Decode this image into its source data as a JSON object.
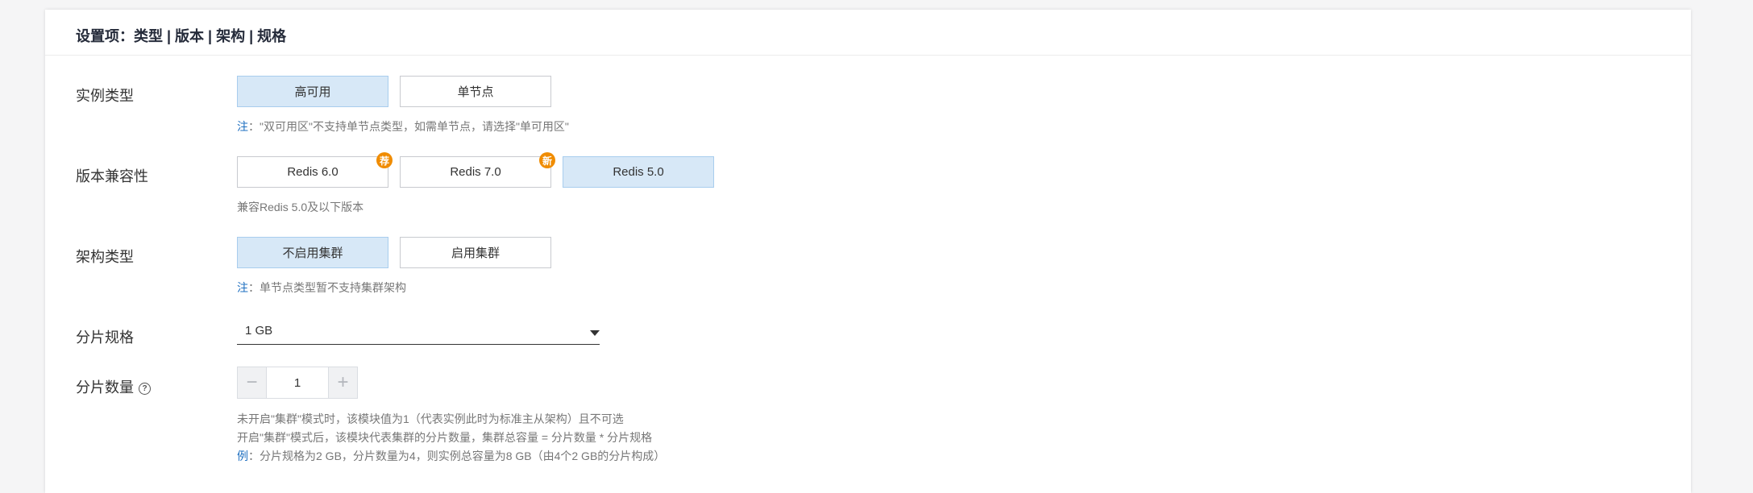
{
  "header": {
    "title": "设置项：类型 | 版本 | 架构 | 规格"
  },
  "instance_type": {
    "label": "实例类型",
    "options": [
      {
        "label": "高可用",
        "selected": true
      },
      {
        "label": "单节点",
        "selected": false
      }
    ],
    "note_lead": "注",
    "note_text": "：\"双可用区\"不支持单节点类型，如需单节点，请选择\"单可用区\""
  },
  "version": {
    "label": "版本兼容性",
    "options": [
      {
        "label": "Redis 6.0",
        "badge": "荐",
        "selected": false
      },
      {
        "label": "Redis 7.0",
        "badge": "新",
        "selected": false
      },
      {
        "label": "Redis 5.0",
        "badge": "",
        "selected": true
      }
    ],
    "note_text": "兼容Redis 5.0及以下版本"
  },
  "architecture": {
    "label": "架构类型",
    "options": [
      {
        "label": "不启用集群",
        "selected": true
      },
      {
        "label": "启用集群",
        "selected": false
      }
    ],
    "note_lead": "注",
    "note_text": "：单节点类型暂不支持集群架构"
  },
  "shard_spec": {
    "label": "分片规格",
    "value": "1 GB"
  },
  "shard_count": {
    "label": "分片数量",
    "value": "1",
    "help_icon": "?",
    "notes": [
      "未开启\"集群\"模式时，该模块值为1（代表实例此时为标准主从架构）且不可选",
      "开启\"集群\"模式后，该模块代表集群的分片数量，集群总容量 = 分片数量 * 分片规格"
    ],
    "example_lead": "例",
    "example_text": "：分片规格为2 GB，分片数量为4，则实例总容量为8 GB（由4个2 GB的分片构成）"
  },
  "colors": {
    "selected_bg": "#d7e8f7",
    "selected_border": "#a8cdee",
    "badge": "#f08c00",
    "link_blue": "#1e6fc0"
  }
}
